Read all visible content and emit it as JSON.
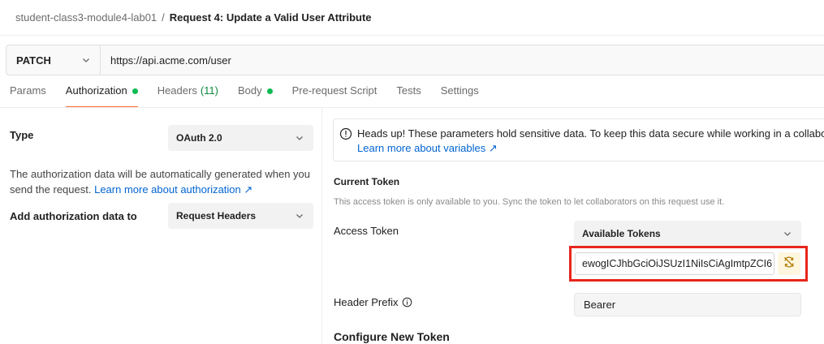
{
  "breadcrumb": {
    "parent": "student-class3-module4-lab01",
    "separator": "/",
    "current": "Request 4: Update a Valid User Attribute"
  },
  "request": {
    "method": "PATCH",
    "url": "https://api.acme.com/user"
  },
  "tabs": [
    {
      "label": "Params"
    },
    {
      "label": "Authorization",
      "active": true,
      "dot": true
    },
    {
      "label": "Headers",
      "count": "(11)"
    },
    {
      "label": "Body",
      "dot": true
    },
    {
      "label": "Pre-request Script"
    },
    {
      "label": "Tests"
    },
    {
      "label": "Settings"
    }
  ],
  "auth": {
    "type_label": "Type",
    "type_value": "OAuth 2.0",
    "description": "The authorization data will be automatically generated when you send the request.",
    "learn_more_link": "Learn more about authorization ↗",
    "add_to_label": "Add authorization data to",
    "add_to_value": "Request Headers"
  },
  "alert": {
    "text": "Heads up! These parameters hold sensitive data. To keep this data secure while working in a collaborative environment",
    "link": "Learn more about variables ↗"
  },
  "current_token": {
    "title": "Current Token",
    "subtitle": "This access token is only available to you. Sync the token to let collaborators on this request use it.",
    "access_token_label": "Access Token",
    "available_tokens": "Available Tokens",
    "token_value": "ewogICJhbGciOiJSUzI1NiIsCiAgImtpZCI6",
    "header_prefix_label": "Header Prefix",
    "header_prefix_value": "Bearer"
  },
  "configure": {
    "title": "Configure New Token"
  },
  "colors": {
    "accent": "#ff6c37",
    "dot": "#0cbb52",
    "link": "#0265d2",
    "highlight": "#e8251c"
  }
}
